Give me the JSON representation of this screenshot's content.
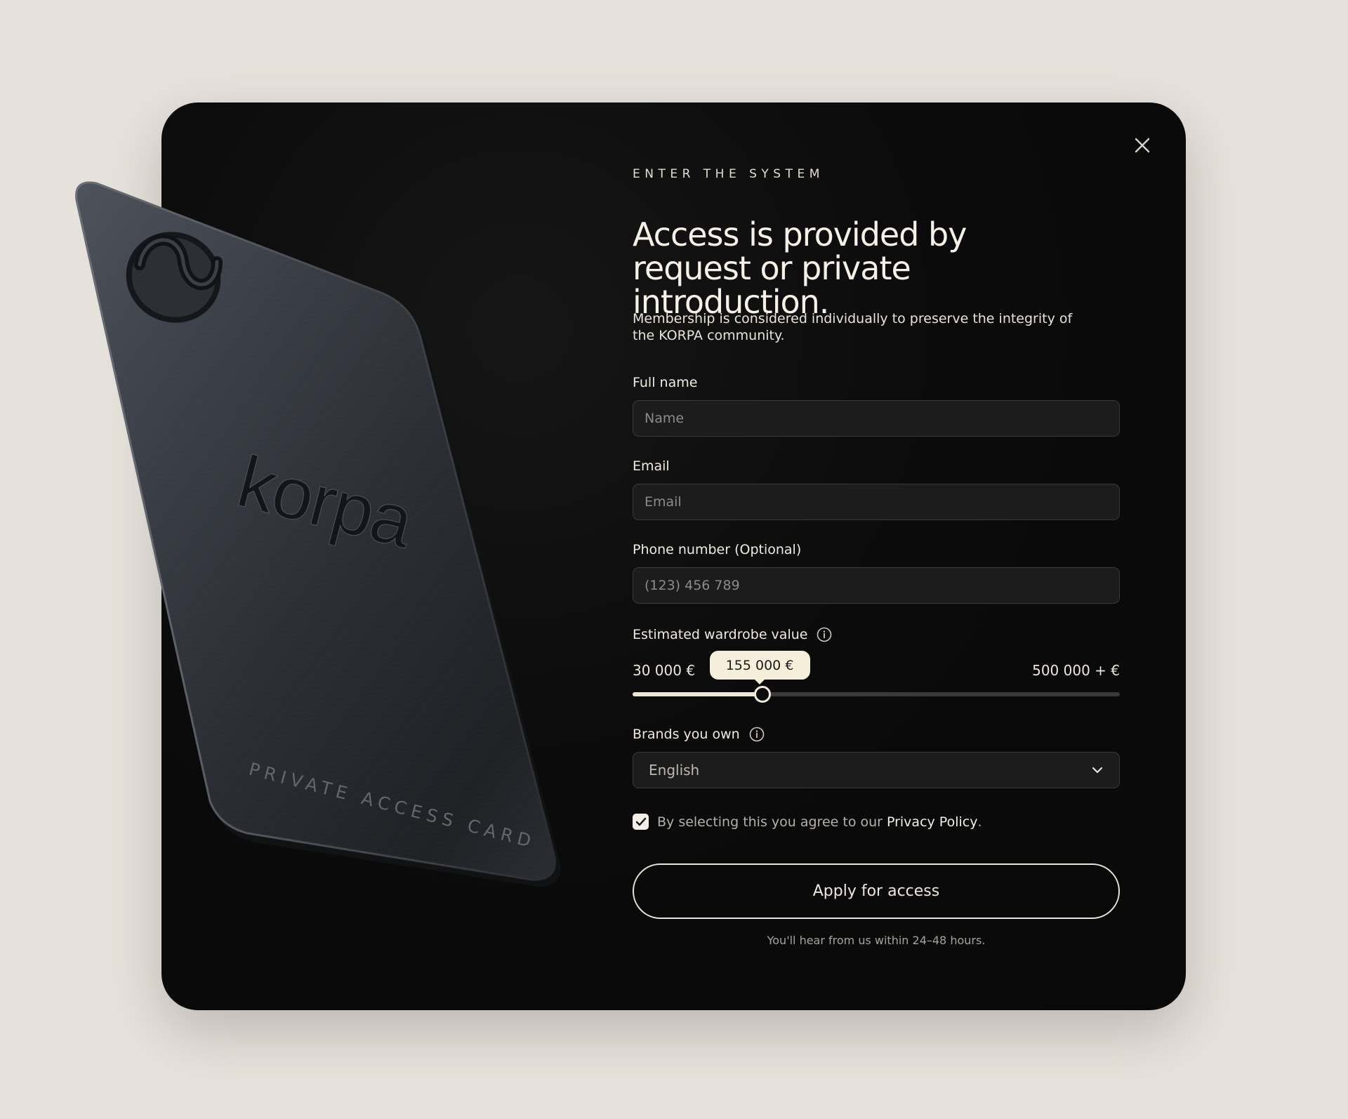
{
  "modal": {
    "eyebrow": "ENTER THE SYSTEM",
    "headline": "Access is provided by request or private introduction.",
    "subcopy": "Membership is considered individually to preserve the integrity of the KORPA community."
  },
  "card": {
    "brand": "korpa",
    "caption": "PRIVATE ACCESS CARD"
  },
  "form": {
    "full_name": {
      "label": "Full name",
      "placeholder": "Name",
      "value": ""
    },
    "email": {
      "label": "Email",
      "placeholder": "Email",
      "value": ""
    },
    "phone": {
      "label": "Phone number (Optional)",
      "placeholder": "(123) 456 789",
      "value": ""
    },
    "wardrobe": {
      "label": "Estimated wardrobe value",
      "min_label": "30 000 €",
      "max_label": "500 000 + €",
      "current_label": "155 000 €",
      "min": 30000,
      "max": 500000,
      "value": 155000
    },
    "brands": {
      "label": "Brands you own",
      "selected": "English"
    },
    "consent": {
      "text": "By selecting this you agree to our",
      "link": "Privacy Policy",
      "suffix": ".",
      "checked": true
    },
    "submit_label": "Apply for access",
    "footnote": "You'll hear from us within 24–48 hours."
  },
  "colors": {
    "page_bg": "#e6e1da",
    "modal_bg": "#0b0b0b",
    "accent_cream": "#f4eedb",
    "input_bg": "#1c1c1c"
  },
  "icons": {
    "close": "close-icon",
    "info": "info-icon",
    "dropdown": "chevron-down-icon",
    "check": "checkmark-icon"
  }
}
